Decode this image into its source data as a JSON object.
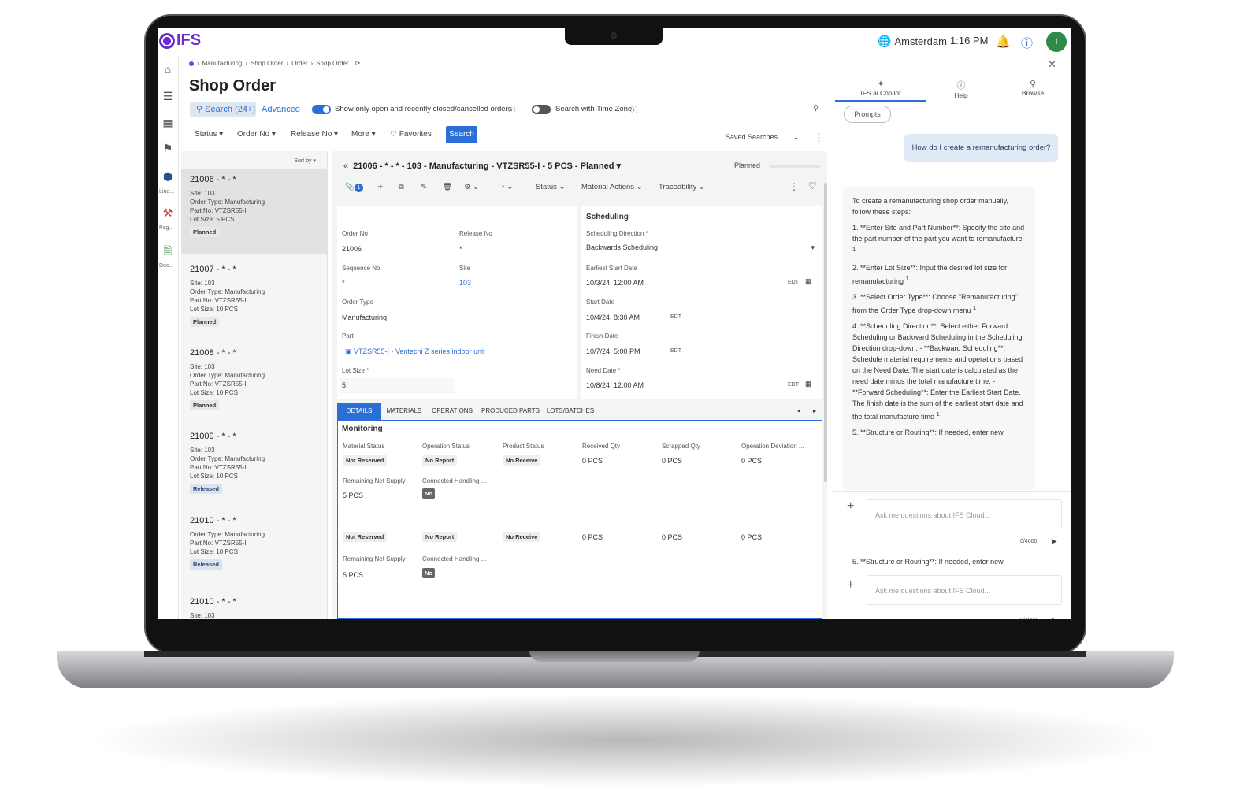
{
  "app": {
    "logo": "IFS",
    "location": "Amsterdam",
    "time": "1:16 PM",
    "user_initial": "I"
  },
  "rail": {
    "labels": [
      "Line...",
      "Pag...",
      "Doc..."
    ]
  },
  "breadcrumb": [
    "Manufacturing",
    "Shop Order",
    "Order",
    "Shop Order"
  ],
  "page": {
    "title": "Shop Order",
    "search_btn": "Search (24+)",
    "advanced": "Advanced",
    "toggle1": "Show only open and recently closed/cancelled orders",
    "toggle2": "Search with Time Zone",
    "filters": [
      "Status",
      "Order No",
      "Release No",
      "More",
      "Favorites"
    ],
    "search": "Search",
    "saved_searches": "Saved Searches"
  },
  "list": {
    "sort_by": "Sort by",
    "items": [
      {
        "title": "21006 - * - *",
        "site": "Site:  103",
        "otype": "Order Type:  Manufacturing",
        "part": "Part No:  VTZSR55-I",
        "lot": "Lot Size:  5 PCS",
        "status": "Planned"
      },
      {
        "title": "21007 - * - *",
        "site": "Site:  103",
        "otype": "Order Type:  Manufacturing",
        "part": "Part No:  VTZSR55-I",
        "lot": "Lot Size:  10 PCS",
        "status": "Planned"
      },
      {
        "title": "21008 - * - *",
        "site": "Site:  103",
        "otype": "Order Type:  Manufacturing",
        "part": "Part No:  VTZSR55-I",
        "lot": "Lot Size:  10 PCS",
        "status": "Planned"
      },
      {
        "title": "21009 - * - *",
        "site": "Site:  103",
        "otype": "Order Type:  Manufacturing",
        "part": "Part No:  VTZSR55-I",
        "lot": "Lot Size:  10 PCS",
        "status": "Released"
      },
      {
        "title": "21010 - * - *",
        "otype": "Order Type:  Manufacturing",
        "part": "Part No:  VTZSR55-I",
        "lot": "Lot Size:  10 PCS",
        "status": "Released"
      },
      {
        "title": "21010 - * - *",
        "site": "Site:  103"
      }
    ]
  },
  "detail": {
    "header": "21006 - * - * - 103 - Manufacturing - VTZSR55-I - 5 PCS - Planned",
    "state": "Planned",
    "attach_count": "1",
    "toolbar": [
      "Status",
      "Material Actions",
      "Traceability"
    ],
    "fields": {
      "order_no_label": "Order No",
      "order_no": "21006",
      "release_no_label": "Release No",
      "release_no": "*",
      "sequence_no_label": "Sequence No",
      "sequence_no": "*",
      "site_label": "Site",
      "site": "103",
      "order_type_label": "Order Type",
      "order_type": "Manufacturing",
      "part_label": "Part",
      "part": "VTZSR55-I - Ventechi Z series indoor unit",
      "lot_size_label": "Lot Size",
      "lot_size": "5"
    },
    "scheduling": {
      "title": "Scheduling",
      "direction_label": "Scheduling Direction",
      "direction": "Backwards Scheduling",
      "earliest_label": "Earliest Start Date",
      "earliest": "10/3/24, 12:00 AM",
      "start_label": "Start Date",
      "start": "10/4/24, 8:30 AM",
      "finish_label": "Finish Date",
      "finish": "10/7/24, 5:00 PM",
      "need_label": "Need Date",
      "need": "10/8/24, 12:00 AM",
      "tz": "EDT",
      "required": "*"
    },
    "tabs": [
      "DETAILS",
      "MATERIALS",
      "OPERATIONS",
      "PRODUCED PARTS",
      "LOTS/BATCHES"
    ],
    "monitoring": {
      "title": "Monitoring",
      "headers": [
        "Material Status",
        "Operation Status",
        "Product Status",
        "Received Qty",
        "Scrapped Qty",
        "Operation Deviation ..."
      ],
      "row": [
        "Not Reserved",
        "No Report",
        "No Receive",
        "0 PCS",
        "0 PCS",
        "0 PCS"
      ],
      "rns_label": "Remaining Net Supply",
      "rns": "5 PCS",
      "chu_label": "Connected Handling ...",
      "chu": "No"
    }
  },
  "side": {
    "tabs": [
      "IFS.ai Copilot",
      "Help",
      "Browse"
    ],
    "prompts": "Prompts",
    "question": "How do I create a remanufacturing order?",
    "answer": [
      "To create a remanufacturing shop order manually, follow these steps:",
      "1. **Enter Site and Part Number**: Specify the site and the part number of the part you want to remanufacture",
      "2. **Enter Lot Size**: Input the desired lot size for remanufacturing",
      "3. **Select Order Type**: Choose \"Remanufacturing\" from the Order Type drop-down menu",
      "4. **Scheduling Direction**: Select either Forward Scheduling or Backward Scheduling in the Scheduling Direction drop-down. - **Backward Scheduling**: Schedule material requirements and operations based on the Need Date. The start date is calculated as the need date minus the total manufacture time. - **Forward Scheduling**: Enter the Earliest Start Date. The finish date is the sum of the earliest start date and the total manufacture time",
      "5. **Structure or Routing**: If needed, enter new"
    ],
    "footnote": "1",
    "ask_placeholder": "Ask me questions about IFS Cloud...",
    "counter": "0/4000",
    "dup_line": "5. **Structure or Routing**: If needed, enter new"
  }
}
